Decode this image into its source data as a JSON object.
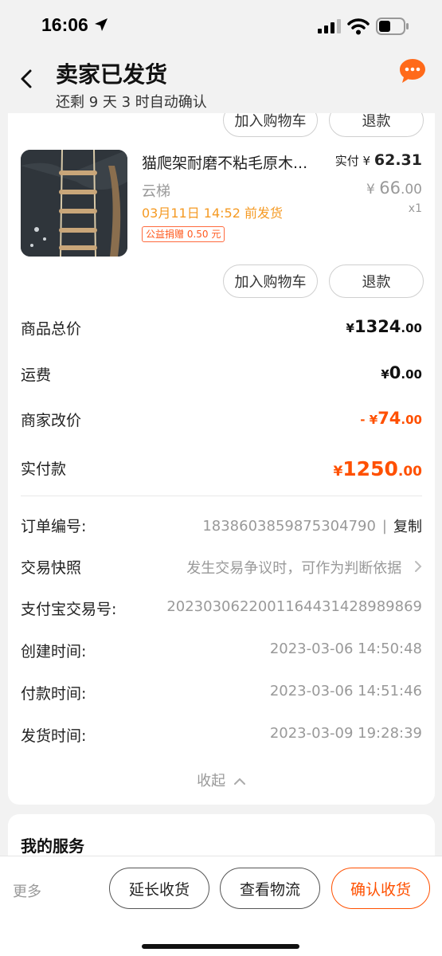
{
  "status_bar": {
    "time": "16:06"
  },
  "header": {
    "title": "卖家已发货",
    "subtitle": "还剩 9 天 3 时自动确认"
  },
  "product": {
    "name": "猫爬架耐磨不粘毛原木...",
    "spec": "云梯",
    "ship_deadline": "03月11日 14:52 前发货",
    "charity_tag": "公益捐赠 0.50 元",
    "paid_label": "实付",
    "paid_currency": "¥",
    "paid_int": "62",
    "paid_dec": ".31",
    "orig_currency": "¥",
    "orig_int": "66",
    "orig_dec": ".00",
    "quantity": "x1",
    "add_to_cart_label": "加入购物车",
    "refund_label": "退款"
  },
  "summary": {
    "goods_total": {
      "label": "商品总价",
      "currency": "¥",
      "int": "1324",
      "dec": ".00"
    },
    "shipping": {
      "label": "运费",
      "currency": "¥",
      "int": "0",
      "dec": ".00"
    },
    "seller_adjust": {
      "label": "商家改价",
      "currency": "- ¥",
      "int": "74",
      "dec": ".00"
    },
    "actual_paid": {
      "label": "实付款",
      "currency": "¥",
      "int": "1250",
      "dec": ".00"
    }
  },
  "order_info": {
    "order_no": {
      "label": "订单编号:",
      "value": "1838603859875304790",
      "sep": "|",
      "action": "复制"
    },
    "snapshot": {
      "label": "交易快照",
      "value": "发生交易争议时，可作为判断依据"
    },
    "alipay_no": {
      "label": "支付宝交易号:",
      "value": "2023030622001164431428989869"
    },
    "created": {
      "label": "创建时间:",
      "value": "2023-03-06 14:50:48"
    },
    "paid": {
      "label": "付款时间:",
      "value": "2023-03-06 14:51:46"
    },
    "shipped": {
      "label": "发货时间:",
      "value": "2023-03-09 19:28:39"
    },
    "collapse_label": "收起"
  },
  "services": {
    "title": "我的服务"
  },
  "bottom_bar": {
    "more": "更多",
    "extend": "延长收货",
    "logistics": "查看物流",
    "confirm": "确认收货"
  },
  "colors": {
    "accent": "#ff5000",
    "warning": "#f59a23",
    "muted": "#999999"
  }
}
